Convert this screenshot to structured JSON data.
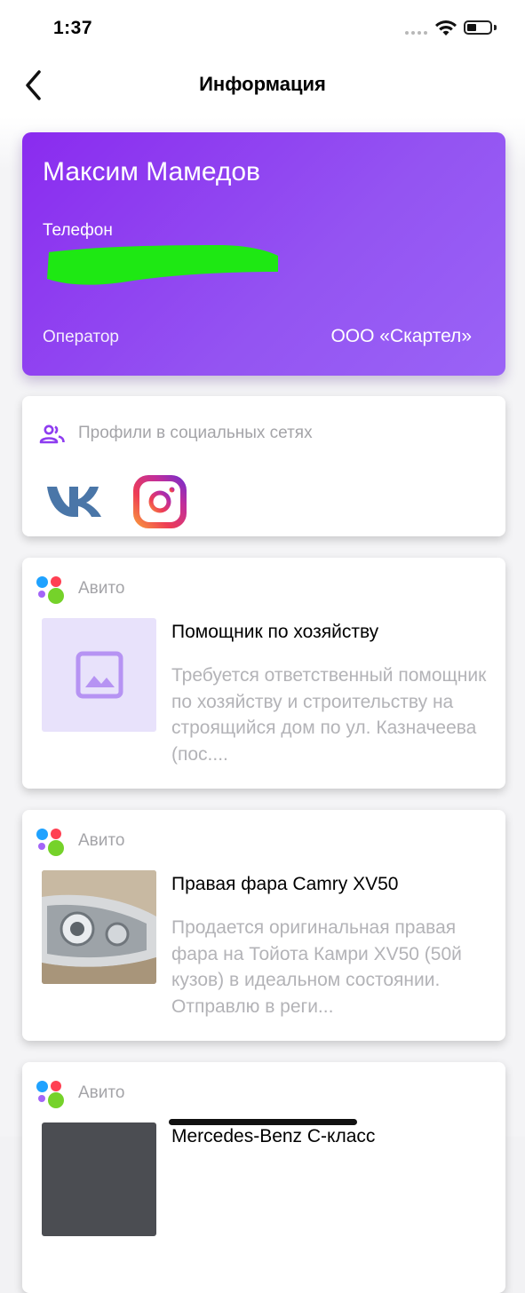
{
  "status_bar": {
    "time": "1:37",
    "battery_level": 0.35
  },
  "nav": {
    "title": "Информация",
    "back_icon": "chevron-left-icon"
  },
  "contact": {
    "name": "Максим Мамедов",
    "phone_label": "Телефон",
    "phone_value_redacted": true,
    "operator_label": "Оператор",
    "operator_value": "ООО «Скартел»",
    "gradient_colors": [
      "#8a2bef",
      "#9a63f6"
    ]
  },
  "social": {
    "title": "Профили в социальных сетях",
    "header_icon": "people-icon",
    "networks": [
      "vk-icon",
      "instagram-icon"
    ]
  },
  "ads": [
    {
      "source": "Авито",
      "title": "Помощник по хозяйству",
      "description": "Требуется ответственный помощник по хозяйству и строительству на строящийся дом по ул. Казначеева (пос....",
      "thumbnail": "image-placeholder-icon"
    },
    {
      "source": "Авито",
      "title": "Правая фара Camry XV50",
      "description": "Продается оригинальная правая фара на Тойота Камри XV50 (50й кузов) в идеальном состоянии. Отправлю в реги...",
      "thumbnail": "headlight-photo"
    },
    {
      "source": "Авито",
      "title": "Mercedes-Benz C-класс",
      "description": "",
      "thumbnail": "car-photo"
    }
  ],
  "colors": {
    "accent": "#8a2bef",
    "muted_text": "#b3b3b7",
    "avito_blue": "#1fa2ff",
    "avito_red": "#ff4053",
    "avito_purple": "#a365f7",
    "avito_green": "#75d22a"
  }
}
